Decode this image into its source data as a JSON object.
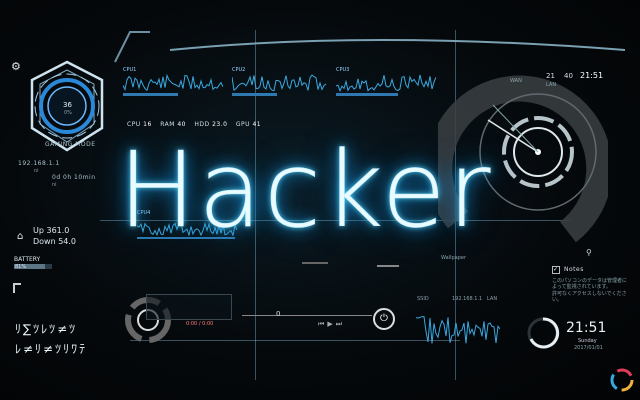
{
  "title": "Hacker",
  "left_panel": {
    "center_value": "36",
    "center_unit": "0%",
    "mode_label": "GAMING MODE",
    "ip": "192.168.1.1",
    "ip_sub": "ni",
    "uptime": "0d 0h 10min",
    "uptime_sub": "ni",
    "up_label": "Up 361.0",
    "down_label": "Down 54.0",
    "battery_label": "BATTERY",
    "battery_value": "81%",
    "glyph_row1": "ﾘ∑ﾂﾚﾂ≠ﾂ",
    "glyph_row2": "ﾚ≠ﾘ≠ﾂﾘﾜﾃ"
  },
  "top_graphs": [
    {
      "label": "CPU1",
      "fill": 0.55
    },
    {
      "label": "CPU2",
      "fill": 0.45
    },
    {
      "label": "CPU3",
      "fill": 0.62
    }
  ],
  "stats_row": {
    "cpu_label": "CPU",
    "cpu_value": "16",
    "ram_label": "RAM",
    "ram_value": "40",
    "hdd_label": "HDD",
    "hdd_value": "23.0",
    "gpu_label": "GPU",
    "gpu_value": "41"
  },
  "mid_graph_label": "CPU4",
  "radar": {
    "label_left": "21",
    "label_left_sub": "WAN",
    "label_right": "40",
    "label_right_sub": "LAN",
    "big_value": "21:51",
    "small_label": "SSD"
  },
  "notes": {
    "title": "Notes",
    "line1": "このパソコンのデータは管理者によって監視されています。",
    "line2": "許可なくアクセスしないでください。"
  },
  "clock": {
    "time": "21:51",
    "day": "Sunday",
    "date": "2017/01/01"
  },
  "player": {
    "track_value": "0",
    "power_icon": "power-icon"
  },
  "net_stats": {
    "ssid": "SSID",
    "ip_label": "192.168.1.1",
    "lan": "LAN"
  },
  "mini_labels": {
    "center_small": "Wallpaper",
    "player_small": "0:00 / 0:00"
  },
  "colors": {
    "accent": "#40c8ff",
    "wave": "#3aa8e0",
    "text": "#e9fbff"
  }
}
